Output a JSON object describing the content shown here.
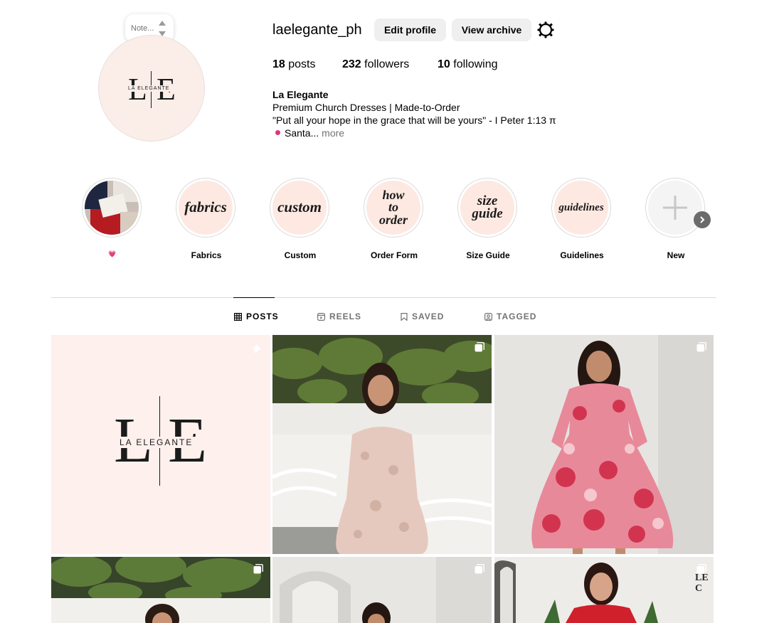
{
  "note": {
    "placeholder": "Note..."
  },
  "profile": {
    "brand_initials_left": "L",
    "brand_initials_right": "E",
    "brand_wordmark": "LA ELEGANTE",
    "username": "laelegante_ph",
    "edit_profile": "Edit profile",
    "view_archive": "View archive",
    "settings_icon": "gear-icon"
  },
  "stats": {
    "posts_count": "18",
    "posts_label": "posts",
    "followers_count": "232",
    "followers_label": "followers",
    "following_count": "10",
    "following_label": "following"
  },
  "bio": {
    "name": "La Elegante",
    "line1": "Premium Church Dresses | Made-to-Order",
    "line2": "\"Put all your hope in the grace that will be yours\" - I Peter 1:13 π",
    "line3": "Santa...",
    "more": "more"
  },
  "highlights": [
    {
      "label": "💗",
      "cover": "photo"
    },
    {
      "label": "Fabrics",
      "cover_text": "fabrics"
    },
    {
      "label": "Custom",
      "cover_text": "custom"
    },
    {
      "label": "Order Form",
      "cover_text": "how to order"
    },
    {
      "label": "Size Guide",
      "cover_text": "size guide"
    },
    {
      "label": "Guidelines",
      "cover_text": "guidelines"
    },
    {
      "label": "New",
      "cover": "plus-icon"
    }
  ],
  "tabs": [
    {
      "label": "POSTS",
      "icon": "grid-icon",
      "active": true
    },
    {
      "label": "REELS",
      "icon": "reels-icon",
      "active": false
    },
    {
      "label": "SAVED",
      "icon": "bookmark-icon",
      "active": false
    },
    {
      "label": "TAGGED",
      "icon": "tag-icon",
      "active": false
    }
  ],
  "grid_posts": [
    {
      "kind": "logo",
      "icon": "pin-icon"
    },
    {
      "kind": "photo",
      "subject": "woman in blush brocade dress",
      "icon": "carousel-icon"
    },
    {
      "kind": "photo",
      "subject": "woman in pink floral dress",
      "icon": "carousel-icon"
    },
    {
      "kind": "photo",
      "subject": "woman among green leaves",
      "icon": "carousel-icon"
    },
    {
      "kind": "photo",
      "subject": "woman by white arch",
      "icon": "carousel-icon"
    },
    {
      "kind": "photo",
      "subject": "woman in red dress",
      "icon": "carousel-icon",
      "sign_text": "LE C"
    }
  ],
  "colors": {
    "brand_blush": "#fbeee9",
    "highlight_fill": "#fde9e1",
    "button_bg": "#efefef",
    "muted_text": "#737373",
    "divider": "#dbdbdb"
  }
}
